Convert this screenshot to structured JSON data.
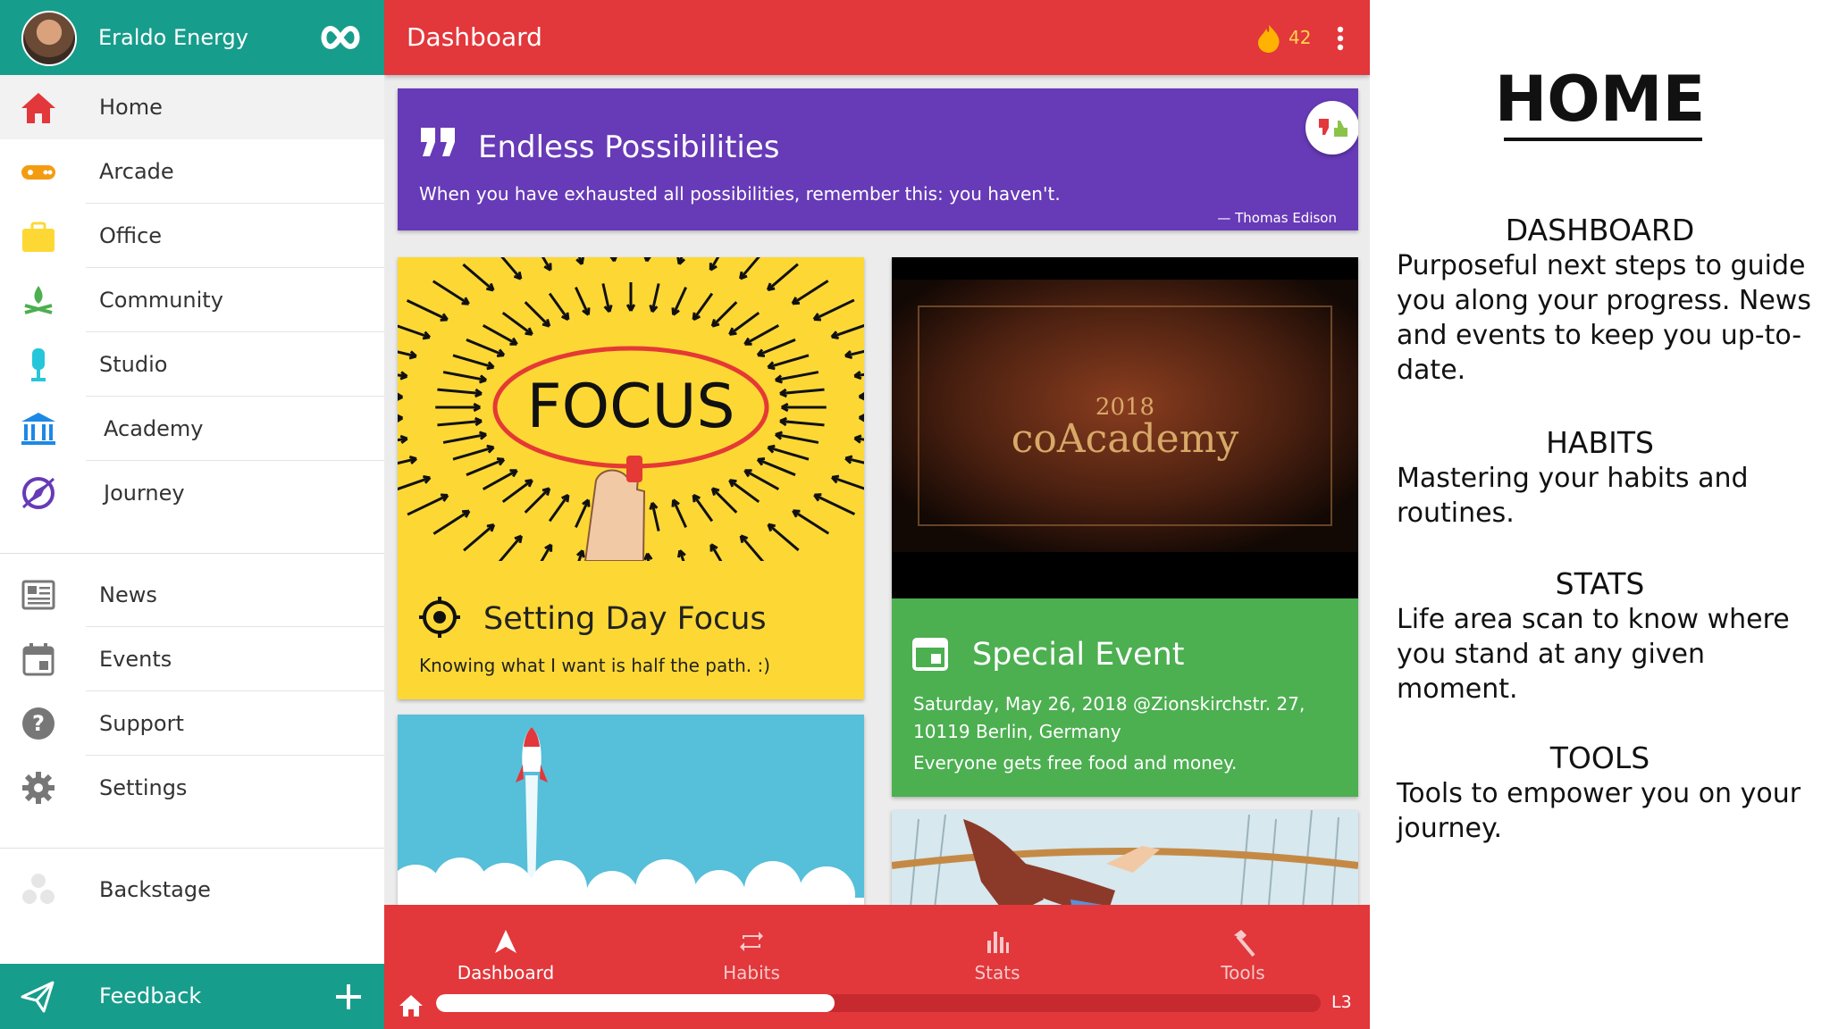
{
  "sidebar": {
    "user_name": "Eraldo Energy",
    "items": [
      {
        "label": "Home",
        "icon": "home-icon",
        "color": "#e2373b"
      },
      {
        "label": "Arcade",
        "icon": "gamepad-icon",
        "color": "#f39c12"
      },
      {
        "label": "Office",
        "icon": "briefcase-icon",
        "color": "#fdd835"
      },
      {
        "label": "Community",
        "icon": "campfire-icon",
        "color": "#4caf50"
      },
      {
        "label": "Studio",
        "icon": "microphone-icon",
        "color": "#26c6da"
      },
      {
        "label": "Academy",
        "icon": "academy-building-icon",
        "color": "#1e88e5"
      },
      {
        "label": "Journey",
        "icon": "compass-icon",
        "color": "#673ab7"
      },
      {
        "label": "News",
        "icon": "newspaper-icon",
        "color": "#777777"
      },
      {
        "label": "Events",
        "icon": "calendar-icon",
        "color": "#777777"
      },
      {
        "label": "Support",
        "icon": "help-icon",
        "color": "#777777"
      },
      {
        "label": "Settings",
        "icon": "gear-icon",
        "color": "#777777"
      },
      {
        "label": "Backstage",
        "icon": "backstage-icon",
        "color": "#dddddd"
      }
    ],
    "feedback_label": "Feedback"
  },
  "topbar": {
    "title": "Dashboard",
    "points": "42"
  },
  "quote_card": {
    "title": "Endless Possibilities",
    "text": "When you have exhausted all possibilities, remember this: you haven't.",
    "author": "— Thomas Edison"
  },
  "focus_card": {
    "image_text": "FOCUS",
    "title": "Setting Day Focus",
    "subtitle": "Knowing what I want is half the path. :)"
  },
  "event_card": {
    "image_year": "2018",
    "image_title": "coAcademy",
    "title": "Special Event",
    "line1": "Saturday, May 26, 2018 @Zionskirchstr. 27,",
    "line2": "10119 Berlin, Germany",
    "line3": "Everyone gets free food and money."
  },
  "bottom_nav": {
    "tabs": [
      "Dashboard",
      "Habits",
      "Stats",
      "Tools"
    ],
    "level": "L3",
    "progress": 0.45
  },
  "info_panel": {
    "title": "HOME",
    "sections": [
      {
        "heading": "DASHBOARD",
        "text": "Purposeful next steps to guide you along your progress. News and events to keep you up-to-date."
      },
      {
        "heading": "HABITS",
        "text": "Mastering your habits and routines."
      },
      {
        "heading": "STATS",
        "text": "Life area scan to know where you stand at any given moment."
      },
      {
        "heading": "TOOLS",
        "text": "Tools to empower you on your journey."
      }
    ]
  }
}
